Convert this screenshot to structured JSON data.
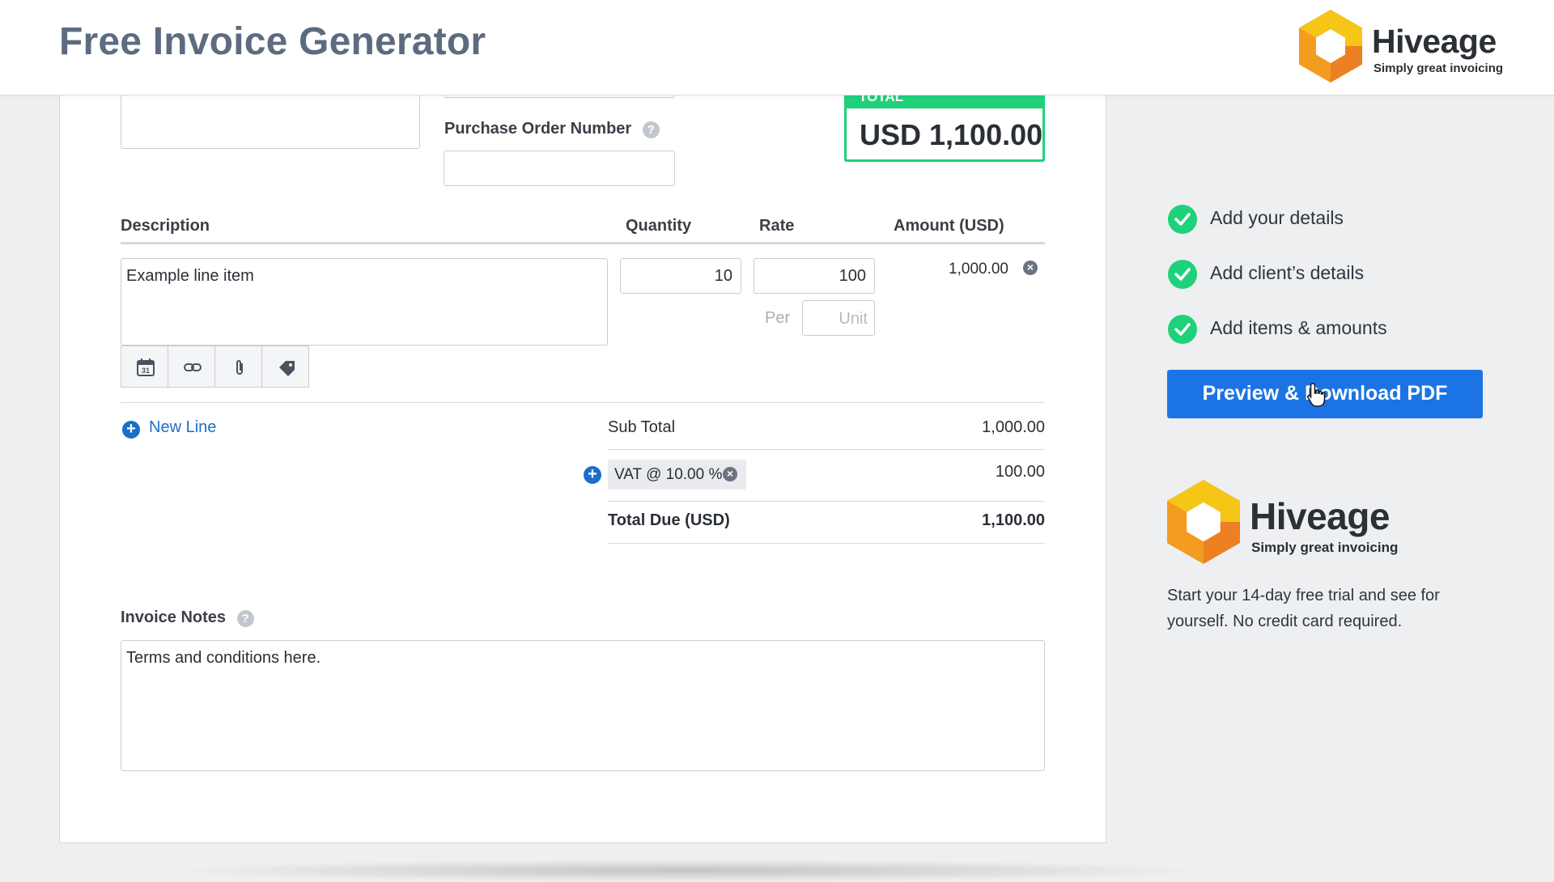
{
  "header": {
    "title": "Free Invoice Generator",
    "brand_name": "Hiveage",
    "brand_tagline": "Simply great invoicing"
  },
  "form": {
    "purchase_order_label": "Purchase Order Number",
    "purchase_order_value": "",
    "total_badge": "TOTAL",
    "total_amount": "USD 1,100.00"
  },
  "items_table": {
    "columns": [
      "Description",
      "Quantity",
      "Rate",
      "Amount (USD)"
    ],
    "rows": [
      {
        "description": "Example line item",
        "quantity": "10",
        "rate": "100",
        "per_label": "Per",
        "unit_placeholder": "Unit",
        "amount": "1,000.00"
      }
    ]
  },
  "totals": {
    "new_line_label": "New Line",
    "subtotal_label": "Sub Total",
    "subtotal_value": "1,000.00",
    "tax_label": "VAT @ 10.00 %",
    "tax_value": "100.00",
    "total_due_label": "Total Due (USD)",
    "total_due_value": "1,100.00"
  },
  "notes": {
    "label": "Invoice Notes",
    "value": "Terms and conditions here."
  },
  "steps": [
    {
      "label": "Add your details",
      "done": true
    },
    {
      "label": "Add client’s details",
      "done": true
    },
    {
      "label": "Add items & amounts",
      "done": true
    }
  ],
  "actions": {
    "preview_download": "Preview & Download PDF"
  },
  "promo": {
    "brand_name": "Hiveage",
    "brand_tagline": "Simply great invoicing",
    "text": "Start your 14-day free trial and see for yourself. No credit card required."
  },
  "icons": {
    "toolbar": [
      "calendar-icon",
      "link-icon",
      "attachment-icon",
      "tag-icon"
    ],
    "calendar_day": "31"
  },
  "colors": {
    "accent_blue": "#1c74e4",
    "success_green": "#1fd17a",
    "title_slate": "#5d6b80",
    "logo_yellow": "#f5c518",
    "logo_orange": "#ee7f22"
  }
}
